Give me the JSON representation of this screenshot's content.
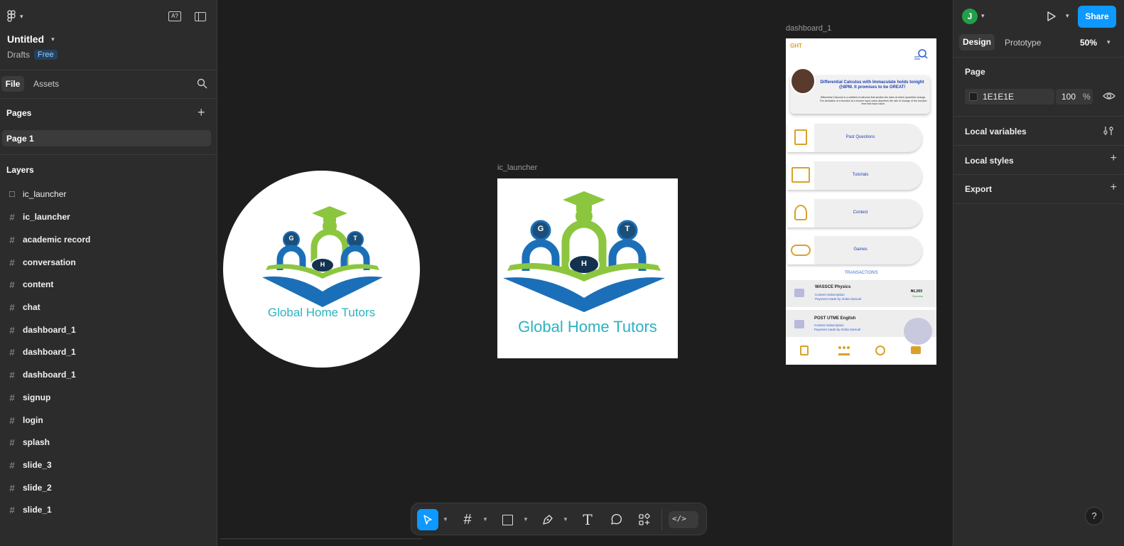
{
  "app": {
    "title": "Untitled",
    "location": "Drafts",
    "plan_badge": "Free"
  },
  "left_tabs": {
    "file": "File",
    "assets": "Assets"
  },
  "pages": {
    "heading": "Pages",
    "items": [
      "Page 1"
    ]
  },
  "layers": {
    "heading": "Layers",
    "items": [
      "ic_launcher",
      "ic_launcher",
      "academic record",
      "conversation",
      "content",
      "chat",
      "dashboard_1",
      "dashboard_1",
      "dashboard_1",
      "signup",
      "login",
      "splash",
      "slide_3",
      "slide_2",
      "slide_1"
    ]
  },
  "right": {
    "avatar_letter": "J",
    "share_label": "Share",
    "tabs": {
      "design": "Design",
      "prototype": "Prototype"
    },
    "zoom": "50%",
    "page_section": "Page",
    "page_color_hex": "1E1E1E",
    "page_opacity": "100",
    "percent": "%",
    "sections": [
      "Local variables",
      "Local styles",
      "Export"
    ]
  },
  "canvas": {
    "frame_label_launcher": "ic_launcher",
    "frame_label_dashboard": "dashboard_1",
    "logo_text": "Global Home Tutors",
    "logo_letters": {
      "left": "G",
      "center": "H",
      "right": "T"
    },
    "dashboard": {
      "brand": "GHT",
      "banner_title": "Differential Calculus with Immaculate holds tonight @8PM. It promises to be GREAT!",
      "banner_body": "Differential Calculus is a subfield of calculus that studies the rates at which quantities change. The derivative of a function at a chosen input value describes the rate of change of the function near that input value.",
      "menu": [
        "Past Questions",
        "Tutorials",
        "Contest",
        "Games"
      ],
      "transactions_label": "TRANSACTIONS",
      "tx": [
        {
          "title": "WASSCE Physics",
          "line1": "Content Subscription",
          "line2": "Payment made by Aloba Samuel",
          "amount": "₦1,000",
          "status": "Success"
        },
        {
          "title": "POST UTME English",
          "line1": "Content Subscription",
          "line2": "Payment made by Aloba Samuel"
        }
      ]
    }
  },
  "colors": {
    "accent": "#0d99ff",
    "panel": "#2c2c2c",
    "canvas": "#1e1e1e",
    "logo_blue": "#1b6fb8",
    "logo_green": "#8cc63f",
    "logo_teal": "#2bb3c0",
    "gold": "#d9a12c"
  },
  "help_label": "?"
}
